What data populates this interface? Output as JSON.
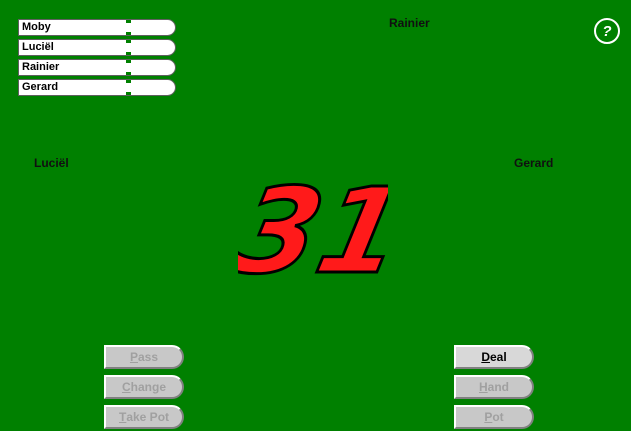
{
  "scoreboard": [
    {
      "name": "Moby"
    },
    {
      "name": "Luciël"
    },
    {
      "name": "Rainier"
    },
    {
      "name": "Gerard"
    }
  ],
  "players": {
    "top": "Rainier",
    "left": "Luciël",
    "right": "Gerard"
  },
  "logo_text": "31",
  "help_icon_text": "?",
  "colors": {
    "table": "#008000",
    "logo_fill": "#ff1a1a",
    "logo_outline": "#000000"
  },
  "buttons": {
    "pass": {
      "hot": "P",
      "rest": "ass",
      "enabled": false
    },
    "change": {
      "hot": "C",
      "rest": "hange",
      "enabled": false
    },
    "take_pot": {
      "hot": "T",
      "rest": "ake Pot",
      "enabled": false
    },
    "deal": {
      "hot": "D",
      "rest": "eal",
      "enabled": true
    },
    "hand": {
      "hot": "H",
      "rest": "and",
      "enabled": false
    },
    "pot": {
      "hot": "P",
      "rest": "ot",
      "enabled": false
    }
  }
}
